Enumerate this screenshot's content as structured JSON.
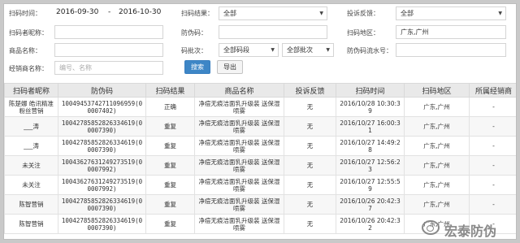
{
  "filters": {
    "scan_time_label": "扫码时间：",
    "date_start": "2016-09-30",
    "date_sep": "-",
    "date_end": "2016-10-30",
    "scan_result_label": "扫码结果：",
    "scan_result_value": "全部",
    "complaint_label": "投诉反馈：",
    "complaint_value": "全部",
    "nickname_label": "扫码者昵称：",
    "anti_code_label": "防伪码：",
    "region_label": "扫码地区：",
    "region_value": "广东,广州",
    "product_label": "商品名称：",
    "batch_label": "码批次：",
    "batch_segment_value": "全部码段",
    "batch_value": "全部批次",
    "serial_label": "防伪码流水号：",
    "dealer_label": "经销商名称：",
    "dealer_placeholder": "编号、名称",
    "search_button": "搜索",
    "export_button": "导出"
  },
  "table": {
    "headers": [
      "扫码者昵称",
      "防伪码",
      "扫码结果",
      "商品名称",
      "投诉反馈",
      "扫码时间",
      "扫码地区",
      "所属经销商"
    ],
    "rows": [
      {
        "nickname": "陈楚娜 皓讯精准粉丝营销",
        "code": "10049453742711096959(00007402)",
        "result": "正确",
        "product": "净痘无痕洁面乳升级装 送保湿喷雾",
        "complaint": "无",
        "time": "2016/10/28 10:30:39",
        "region": "广东,广州",
        "dealer": "-"
      },
      {
        "nickname": "___涛",
        "code": "10042785852826334619(00007390)",
        "result": "重复",
        "product": "净痘无痕洁面乳升级装 送保湿喷雾",
        "complaint": "无",
        "time": "2016/10/27 16:00:31",
        "region": "广东,广州",
        "dealer": "-"
      },
      {
        "nickname": "___涛",
        "code": "10042785852826334619(00007390)",
        "result": "重复",
        "product": "净痘无痕洁面乳升级装 送保湿喷雾",
        "complaint": "无",
        "time": "2016/10/27 14:49:28",
        "region": "广东,广州",
        "dealer": "-"
      },
      {
        "nickname": "未关注",
        "code": "10043627631249273519(00007992)",
        "result": "重复",
        "product": "净痘无痕洁面乳升级装 送保湿喷雾",
        "complaint": "无",
        "time": "2016/10/27 12:56:23",
        "region": "广东,广州",
        "dealer": "-"
      },
      {
        "nickname": "未关注",
        "code": "10043627631249273519(00007992)",
        "result": "重复",
        "product": "净痘无痕洁面乳升级装 送保湿喷雾",
        "complaint": "无",
        "time": "2016/10/27 12:55:59",
        "region": "广东,广州",
        "dealer": "-"
      },
      {
        "nickname": "陈智营销",
        "code": "10042785852826334619(00007390)",
        "result": "重复",
        "product": "净痘无痕洁面乳升级装 送保湿喷雾",
        "complaint": "无",
        "time": "2016/10/26 20:42:37",
        "region": "广东,广州",
        "dealer": "-"
      },
      {
        "nickname": "陈智营销",
        "code": "10042785852826334619(00007390)",
        "result": "重复",
        "product": "净痘无痕洁面乳升级装 送保湿喷雾",
        "complaint": "无",
        "time": "2016/10/26 20:42:32",
        "region": "广东,广州",
        "dealer": "-"
      }
    ]
  },
  "watermark": {
    "text": "宏泰防伪"
  },
  "colors": {
    "primary_button": "#3d86c6",
    "header_bg": "#e9e9e9"
  }
}
